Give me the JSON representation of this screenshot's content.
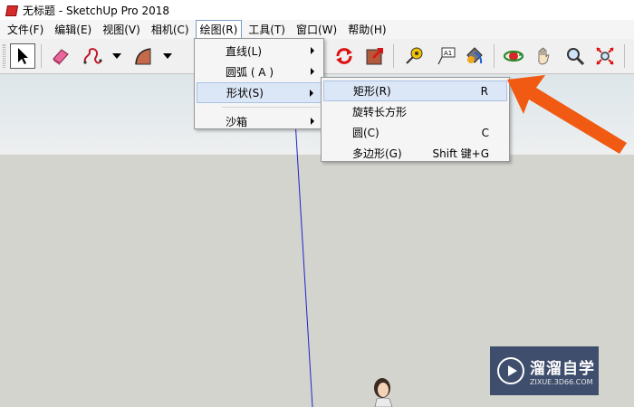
{
  "window": {
    "title": "无标题 - SketchUp Pro 2018"
  },
  "menubar": {
    "items": [
      {
        "label": "文件(F)"
      },
      {
        "label": "编辑(E)"
      },
      {
        "label": "视图(V)"
      },
      {
        "label": "相机(C)"
      },
      {
        "label": "绘图(R)"
      },
      {
        "label": "工具(T)"
      },
      {
        "label": "窗口(W)"
      },
      {
        "label": "帮助(H)"
      }
    ]
  },
  "toolbar": {
    "tools": [
      {
        "icon": "select-arrow-icon"
      },
      {
        "icon": "eraser-icon"
      },
      {
        "icon": "freehand-line-icon"
      },
      {
        "icon": "arc-icon"
      },
      {
        "icon": "rotate-icon"
      },
      {
        "icon": "scale-icon"
      },
      {
        "icon": "tape-measure-icon"
      },
      {
        "icon": "text-label-icon"
      },
      {
        "icon": "paint-bucket-icon"
      },
      {
        "icon": "orbit-icon"
      },
      {
        "icon": "pan-hand-icon"
      },
      {
        "icon": "zoom-icon"
      },
      {
        "icon": "zoom-extents-icon"
      }
    ]
  },
  "draw_menu": {
    "items": [
      {
        "label": "直线(L)",
        "submenu": true
      },
      {
        "label": "圆弧 ( A )",
        "submenu": true
      },
      {
        "label": "形状(S)",
        "submenu": true,
        "highlighted": true
      },
      {
        "label": "沙箱",
        "submenu": true
      }
    ]
  },
  "shapes_submenu": {
    "items": [
      {
        "label": "矩形(R)",
        "shortcut": "R",
        "highlighted": true
      },
      {
        "label": "旋转长方形",
        "shortcut": ""
      },
      {
        "label": "圆(C)",
        "shortcut": "C"
      },
      {
        "label": "多边形(G)",
        "shortcut": "Shift 键+G"
      }
    ]
  },
  "colors": {
    "pointer_arrow": "#f05a12",
    "menu_highlight": "#dbe7f6",
    "axis_blue": "#2222cc",
    "watermark_bg": "#142850"
  },
  "watermark": {
    "main": "溜溜自学",
    "sub": "ZIXUE.3D66.COM"
  }
}
